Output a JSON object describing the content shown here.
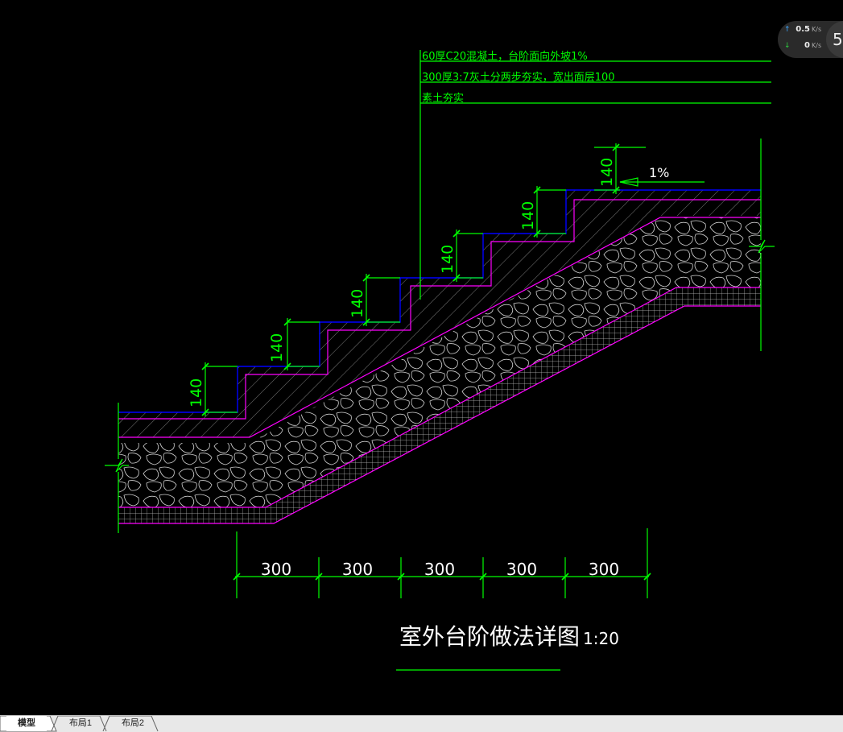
{
  "drawing": {
    "layer_notes": [
      "60厚C20混凝土，台阶面向外坡1%",
      "300厚3:7灰土分两步夯实，宽出面层100",
      "素土夯实"
    ],
    "riser_dims": [
      "140",
      "140",
      "140",
      "140",
      "140",
      "140"
    ],
    "slope_label": "1%",
    "tread_dims": [
      "300",
      "300",
      "300",
      "300",
      "300"
    ],
    "title": "室外台阶做法详图",
    "scale": "1:20",
    "colors": {
      "dimension": "#00ff00",
      "finish_line": "#0000ff",
      "layer_line": "#ff00ff",
      "hatch": "#ffffff",
      "background": "#000000"
    }
  },
  "network_widget": {
    "up_value": "0.5",
    "up_unit": "K/s",
    "down_value": "0",
    "down_unit": "K/s",
    "circle_value": "5"
  },
  "tabs": [
    {
      "label": "模型",
      "active": true
    },
    {
      "label": "布局1",
      "active": false
    },
    {
      "label": "布局2",
      "active": false
    }
  ]
}
